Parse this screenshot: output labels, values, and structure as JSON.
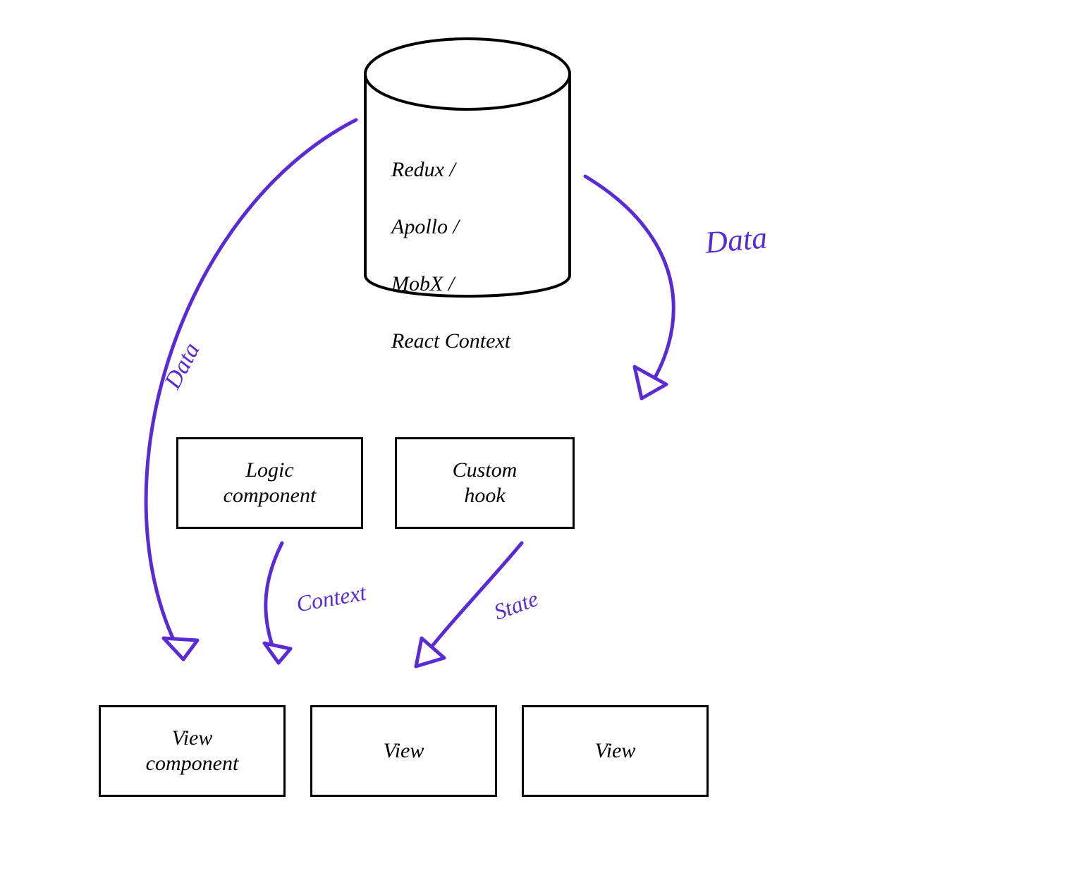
{
  "diagram": {
    "store": {
      "lines": [
        "Redux /",
        "Apollo /",
        "MobX /",
        "React Context"
      ]
    },
    "nodes": {
      "logic_component": "Logic\ncomponent",
      "custom_hook": "Custom\nhook",
      "view_component": "View\ncomponent",
      "view_1": "View",
      "view_2": "View"
    },
    "edges": {
      "data_left": "Data",
      "data_right": "Data",
      "context": "Context",
      "state": "State"
    },
    "colors": {
      "ink": "#000000",
      "arrow": "#5a2ad9"
    }
  }
}
